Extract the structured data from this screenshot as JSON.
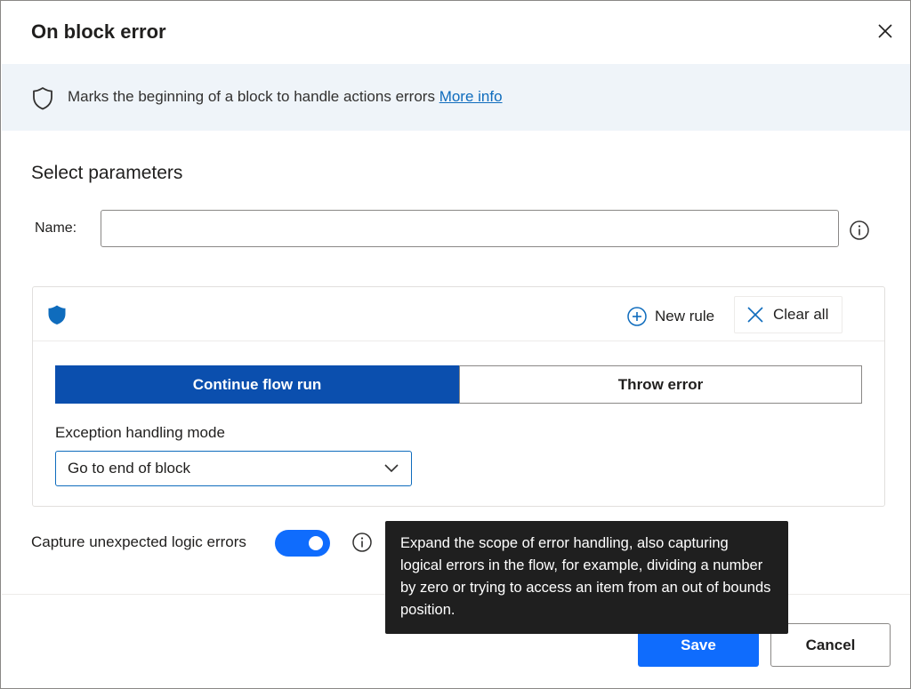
{
  "dialog": {
    "title": "On block error",
    "close_icon": "close-icon"
  },
  "info_banner": {
    "icon": "shield-outline-icon",
    "text": "Marks the beginning of a block to handle actions errors ",
    "link": "More info"
  },
  "parameters": {
    "section_title": "Select parameters",
    "name_label": "Name:",
    "name_value": "",
    "name_info_icon": "info-icon"
  },
  "rules": {
    "icon": "shield-filled-icon",
    "new_rule_label": "New rule",
    "clear_all_label": "Clear all",
    "mode_tabs": [
      {
        "label": "Continue flow run",
        "selected": true
      },
      {
        "label": "Throw error",
        "selected": false
      }
    ],
    "exception_mode_label": "Exception handling mode",
    "exception_mode_value": "Go to end of block"
  },
  "capture": {
    "label": "Capture unexpected logic errors",
    "enabled": true,
    "info_icon": "info-icon"
  },
  "tooltip": {
    "text": "Expand the scope of error handling, also capturing logical errors in the flow, for example, dividing a number by zero or trying to access an item from an out of bounds position."
  },
  "footer": {
    "save_label": "Save",
    "cancel_label": "Cancel"
  },
  "colors": {
    "primary": "#0f6cfd",
    "selected_tab": "#0b4fae",
    "banner_bg": "#eff4f9",
    "link": "#0f6cbd",
    "tooltip_bg": "#1f1f1f"
  }
}
